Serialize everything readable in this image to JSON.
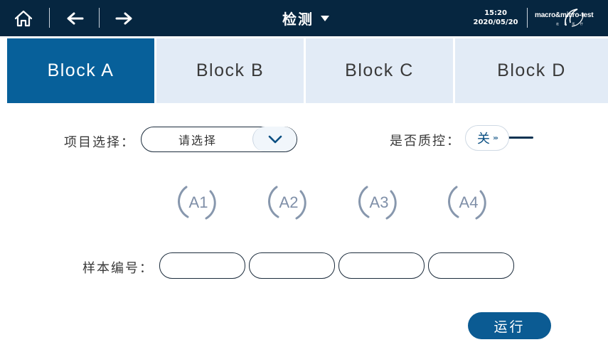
{
  "header": {
    "title": "检测",
    "time": "15:20",
    "date": "2020/05/20",
    "logo_text": "macro&micro-test",
    "logo_subtext": "宏 石 医 疗"
  },
  "tabs": [
    {
      "label": "Block A",
      "active": true
    },
    {
      "label": "Block B",
      "active": false
    },
    {
      "label": "Block C",
      "active": false
    },
    {
      "label": "Block D",
      "active": false
    }
  ],
  "form": {
    "project_label": "项目选择：",
    "project_value": "请选择",
    "qc_label": "是否质控：",
    "qc_value": "关",
    "sample_label": "样本编号："
  },
  "wells": [
    "A1",
    "A2",
    "A3",
    "A4"
  ],
  "samples": [
    "",
    "",
    "",
    ""
  ],
  "actions": {
    "run_label": "运行"
  },
  "colors": {
    "header_bg": "#062640",
    "tab_active": "#07609a",
    "tab_inactive": "#e2ebf6",
    "accent": "#0b5b93",
    "well_ring": "#7f8fa8"
  },
  "icons": {
    "home": "home-icon",
    "back": "arrow-left-icon",
    "forward": "arrow-right-icon",
    "dropdown": "chevron-down-icon",
    "title_caret": "caret-down-icon"
  }
}
